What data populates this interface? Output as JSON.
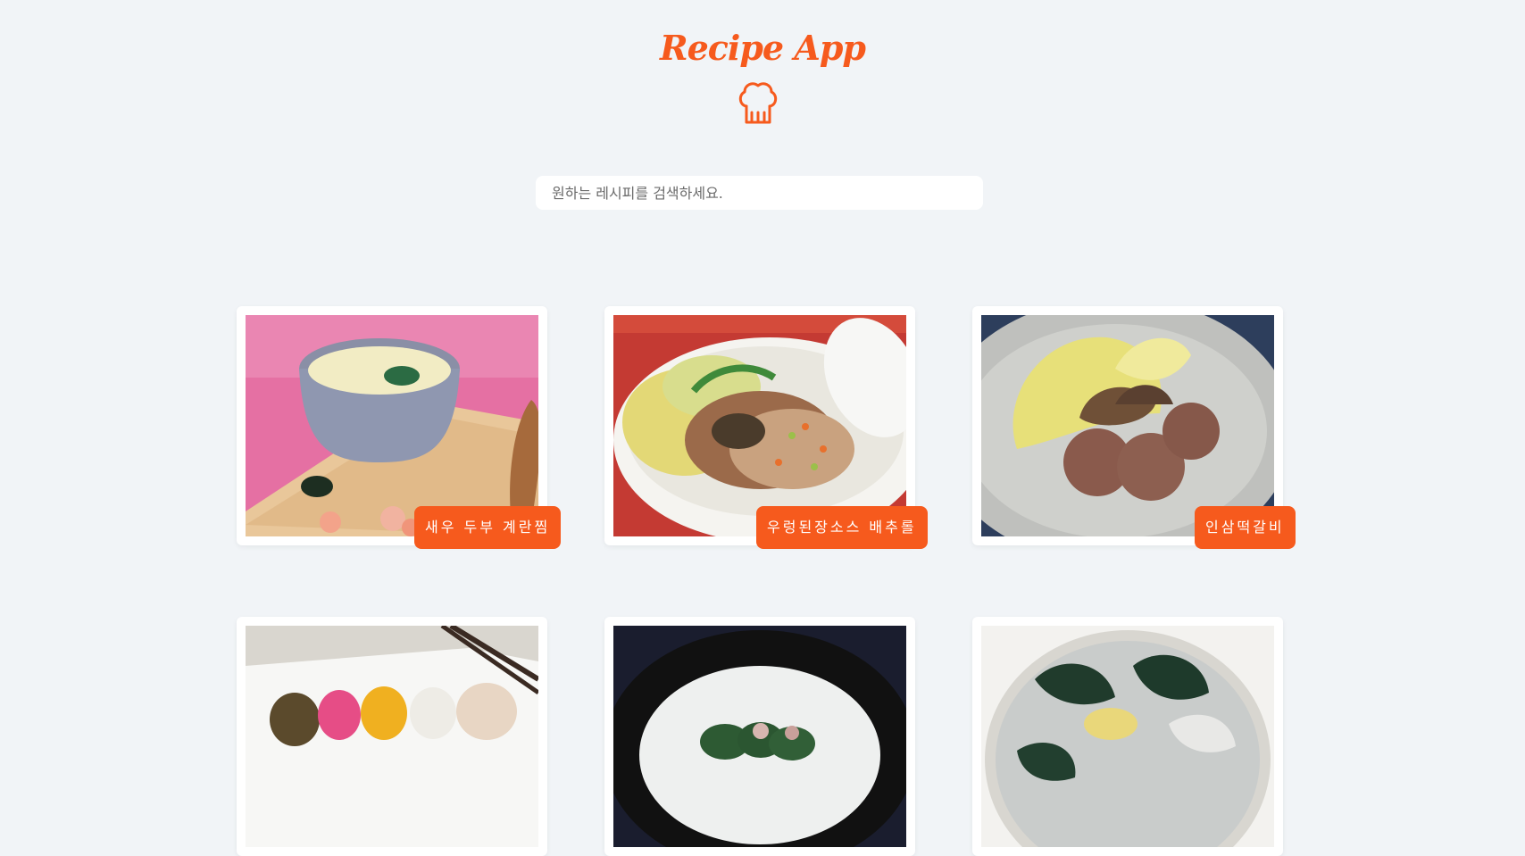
{
  "header": {
    "title": "Recipe App",
    "logo_icon": "chef-hat-icon"
  },
  "search": {
    "placeholder": "원하는 레시피를 검색하세요.",
    "value": ""
  },
  "colors": {
    "accent": "#f65a1d",
    "background": "#f1f4f7",
    "card": "#ffffff"
  },
  "recipes": [
    {
      "name": "새우 두부 계란찜"
    },
    {
      "name": "우렁된장소스 배추롤"
    },
    {
      "name": "인삼떡갈비"
    },
    {
      "name": ""
    },
    {
      "name": ""
    },
    {
      "name": ""
    }
  ]
}
